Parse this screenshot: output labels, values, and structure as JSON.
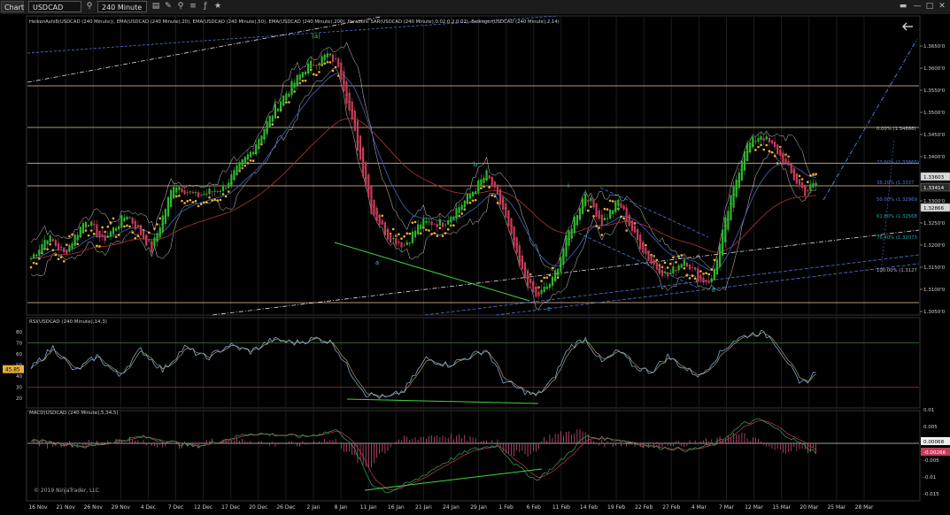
{
  "toolbar": {
    "chart_tab": "Chart",
    "instrument": "USDCAD",
    "interval": "240 Minute",
    "icons": [
      "search-icon",
      "bar-style-icon",
      "drawing-tools-icon",
      "zoom-icon",
      "window-icons"
    ]
  },
  "colors": {
    "bull": "#2fb52f",
    "bear": "#c43c5a",
    "sar": "#f2b233",
    "ema20": "#4b78d6",
    "ema50": "#3c5aa8",
    "ema200": "#a03030",
    "bb": "#cfcfcf",
    "hline": "#f0c8a0",
    "rsi": "#7aa6d8",
    "wave": "#22d3ce",
    "green": "#3fd43f"
  },
  "copyright": "© 2019 NinjaTrader, LLC",
  "price_panel": {
    "indicators": "HeikenAshi8(USDCAD (240 Minute)), EMA(USDCAD (240 Minute),20), EMA(USDCAD (240 Minute),50), EMA(USDCAD (240 Minute),200), Parabolic SAR(USDCAD (240 Minute),0.02,0.2,0.02), Bollinger(USDCAD (240 Minute),2,14)",
    "ticks": [
      "1.3790'0",
      "1.3650'0",
      "1.3600'0",
      "1.3550'0",
      "1.3500'0",
      "1.3450'0",
      "1.3400'0",
      "1.3300'0",
      "1.3250'0",
      "1.3200'0",
      "1.3150'0",
      "1.3100'0",
      "1.3050'0"
    ],
    "price_boxes": [
      {
        "text": "1.33603",
        "style": "light"
      },
      {
        "text": "1.33414",
        "style": "dark"
      },
      {
        "text": "1.32866",
        "style": "light"
      }
    ],
    "wave_labels": [
      {
        "text": "(a)",
        "color": "#3fd43f"
      },
      {
        "text": "a",
        "color": "#22d3ce"
      },
      {
        "text": "b",
        "color": "#22d3ce"
      },
      {
        "text": "c",
        "color": "#22d3ce"
      },
      {
        "text": "i",
        "color": "#22d3ce"
      },
      {
        "text": "ii",
        "color": "#22d3ce"
      }
    ],
    "fib_levels": [
      {
        "text": "0.00% (1.34666)",
        "color": "#bbbbbb"
      },
      {
        "text": "23.60% (1.33865)",
        "color": "#4b78d6"
      },
      {
        "text": "38.20% (1.3337",
        "color": "#4b78d6"
      },
      {
        "text": "50.00% (1.32969",
        "color": "#4b78d6"
      },
      {
        "text": "61.80% (1.32568",
        "color": "#22a8a8"
      },
      {
        "text": "76.40% (1.32073",
        "color": "#22a8a8"
      },
      {
        "text": "100.00% (1.3127",
        "color": "#bbbbbb"
      }
    ]
  },
  "rsi_panel": {
    "title": "RSI(USDCAD (240 Minute),14,3)",
    "ticks": [
      "80",
      "70",
      "60",
      "50",
      "40",
      "30",
      "20"
    ],
    "current": "45.85"
  },
  "macd_panel": {
    "title": "MACD(USDCAD (240 Minute),5,34,5)",
    "ticks": [
      "0.01",
      "0.005",
      "0",
      "-0.005",
      "-0.01",
      "-0.015"
    ],
    "box_pos": "0.00068",
    "box_neg": "-0.00266"
  },
  "x_axis": [
    "16 Nov",
    "21 Nov",
    "26 Nov",
    "29 Nov",
    "4 Dec",
    "7 Dec",
    "12 Dec",
    "17 Dec",
    "20 Dec",
    "26 Dec",
    "2 Jan",
    "8 Jan",
    "11 Jan",
    "16 Jan",
    "21 Jan",
    "24 Jan",
    "29 Jan",
    "1 Feb",
    "6 Feb",
    "11 Feb",
    "14 Feb",
    "19 Feb",
    "22 Feb",
    "27 Feb",
    "4 Mar",
    "7 Mar",
    "12 Mar",
    "15 Mar",
    "20 Mar",
    "25 Mar",
    "28 Mar"
  ],
  "chart_data": {
    "type": "candlestick",
    "instrument": "USDCAD",
    "interval": "240 Minute",
    "x_start": "16 Nov",
    "x_end": "15 Mar",
    "price_path": [
      [
        0,
        1.317
      ],
      [
        6,
        1.322
      ],
      [
        12,
        1.318
      ],
      [
        20,
        1.326
      ],
      [
        26,
        1.321
      ],
      [
        35,
        1.327
      ],
      [
        44,
        1.319
      ],
      [
        52,
        1.334
      ],
      [
        60,
        1.331
      ],
      [
        70,
        1.333
      ],
      [
        80,
        1.341
      ],
      [
        90,
        1.352
      ],
      [
        100,
        1.36
      ],
      [
        108,
        1.363
      ],
      [
        112,
        1.361
      ],
      [
        118,
        1.345
      ],
      [
        124,
        1.328
      ],
      [
        130,
        1.322
      ],
      [
        136,
        1.32
      ],
      [
        142,
        1.325
      ],
      [
        150,
        1.325
      ],
      [
        158,
        1.33
      ],
      [
        166,
        1.336
      ],
      [
        172,
        1.328
      ],
      [
        178,
        1.315
      ],
      [
        184,
        1.308
      ],
      [
        190,
        1.312
      ],
      [
        196,
        1.323
      ],
      [
        202,
        1.332
      ],
      [
        208,
        1.325
      ],
      [
        214,
        1.33
      ],
      [
        220,
        1.322
      ],
      [
        226,
        1.316
      ],
      [
        232,
        1.313
      ],
      [
        238,
        1.317
      ],
      [
        244,
        1.312
      ],
      [
        248,
        1.312
      ],
      [
        254,
        1.328
      ],
      [
        260,
        1.342
      ],
      [
        266,
        1.345
      ],
      [
        272,
        1.341
      ],
      [
        278,
        1.335
      ],
      [
        282,
        1.332
      ],
      [
        286,
        1.334
      ]
    ],
    "horizontal_levels": [
      1.356,
      1.3466,
      1.3385,
      1.3334,
      1.307
    ],
    "rsi_path": [
      [
        0,
        47
      ],
      [
        8,
        66
      ],
      [
        16,
        44
      ],
      [
        24,
        58
      ],
      [
        32,
        40
      ],
      [
        40,
        64
      ],
      [
        48,
        45
      ],
      [
        56,
        66
      ],
      [
        64,
        56
      ],
      [
        72,
        68
      ],
      [
        80,
        62
      ],
      [
        88,
        73
      ],
      [
        96,
        70
      ],
      [
        104,
        74
      ],
      [
        110,
        70
      ],
      [
        116,
        45
      ],
      [
        122,
        24
      ],
      [
        130,
        20
      ],
      [
        136,
        27
      ],
      [
        144,
        56
      ],
      [
        152,
        50
      ],
      [
        160,
        58
      ],
      [
        166,
        64
      ],
      [
        172,
        36
      ],
      [
        178,
        28
      ],
      [
        184,
        22
      ],
      [
        190,
        36
      ],
      [
        196,
        66
      ],
      [
        202,
        74
      ],
      [
        208,
        52
      ],
      [
        214,
        63
      ],
      [
        220,
        48
      ],
      [
        226,
        44
      ],
      [
        232,
        58
      ],
      [
        238,
        47
      ],
      [
        244,
        40
      ],
      [
        250,
        58
      ],
      [
        256,
        72
      ],
      [
        262,
        78
      ],
      [
        266,
        79
      ],
      [
        270,
        74
      ],
      [
        276,
        52
      ],
      [
        280,
        32
      ],
      [
        284,
        38
      ],
      [
        286,
        45
      ]
    ],
    "macd_path": [
      [
        0,
        0.001
      ],
      [
        20,
        -0.001
      ],
      [
        40,
        0.002
      ],
      [
        60,
        -0.001
      ],
      [
        80,
        0.003
      ],
      [
        100,
        0.002
      ],
      [
        112,
        0.004
      ],
      [
        118,
        -0.002
      ],
      [
        124,
        -0.012
      ],
      [
        130,
        -0.0145
      ],
      [
        140,
        -0.011
      ],
      [
        150,
        -0.006
      ],
      [
        160,
        -0.002
      ],
      [
        170,
        -0.0005
      ],
      [
        176,
        -0.006
      ],
      [
        184,
        -0.011
      ],
      [
        192,
        -0.006
      ],
      [
        202,
        0.002
      ],
      [
        214,
        0.001
      ],
      [
        226,
        -0.001
      ],
      [
        240,
        -0.002
      ],
      [
        250,
        0.0
      ],
      [
        260,
        0.006
      ],
      [
        266,
        0.007
      ],
      [
        276,
        0.002
      ],
      [
        286,
        -0.0027
      ]
    ]
  }
}
